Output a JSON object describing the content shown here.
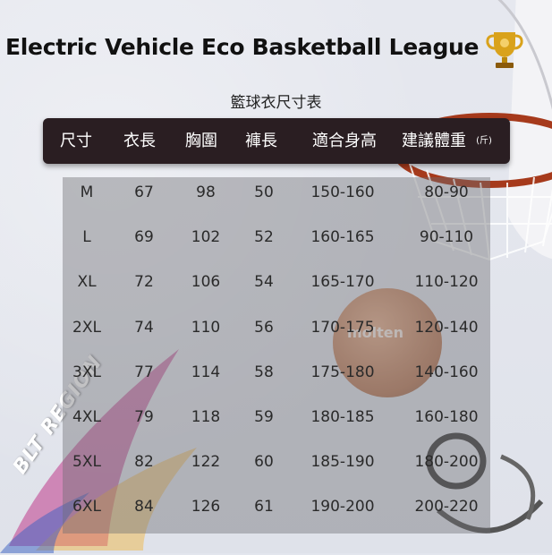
{
  "title": "Electric Vehicle Eco Basketball League",
  "subtitle": "籃球衣尺寸表",
  "headers": [
    "尺寸",
    "衣長",
    "胸圍",
    "褲長",
    "適合身高",
    "建議體重"
  ],
  "weight_unit": "(斤)",
  "rows": [
    [
      "M",
      "67",
      "98",
      "50",
      "150-160",
      "80-90"
    ],
    [
      "L",
      "69",
      "102",
      "52",
      "160-165",
      "90-110"
    ],
    [
      "XL",
      "72",
      "106",
      "54",
      "165-170",
      "110-120"
    ],
    [
      "2XL",
      "74",
      "110",
      "56",
      "170-175",
      "120-140"
    ],
    [
      "3XL",
      "77",
      "114",
      "58",
      "175-180",
      "140-160"
    ],
    [
      "4XL",
      "79",
      "118",
      "59",
      "180-185",
      "160-180"
    ],
    [
      "5XL",
      "82",
      "122",
      "60",
      "185-190",
      "180-200"
    ],
    [
      "6XL",
      "84",
      "126",
      "61",
      "190-200",
      "200-220"
    ]
  ],
  "logo_text": "BLT REGION",
  "ball_brand": "molten",
  "icons": {
    "trophy": "trophy-icon",
    "basketball": "basketball-image",
    "hoop": "basketball-hoop-image"
  },
  "colors": {
    "header_bg": "#2a1e22",
    "header_text": "#ffffff",
    "body_text": "#2a2a2a"
  }
}
